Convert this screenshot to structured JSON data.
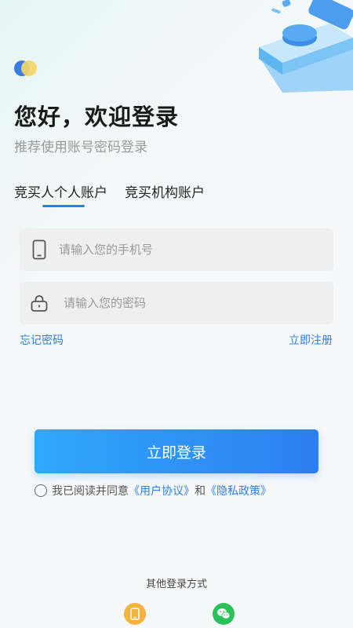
{
  "header": {
    "title": "您好，欢迎登录",
    "subtitle": "推荐使用账号密码登录"
  },
  "tabs": [
    {
      "label": "竞买人个人账户",
      "active": true
    },
    {
      "label": "竞买机构账户",
      "active": false
    }
  ],
  "form": {
    "phone_placeholder": "请输入您的手机号",
    "password_placeholder": "请输入您的密码",
    "forgot_label": "忘记密码",
    "register_label": "立即注册",
    "login_label": "立即登录"
  },
  "agreement": {
    "prefix": "我已阅读并同意",
    "user_protocol": "《用户协议》",
    "and": "和",
    "privacy_policy": "《隐私政策》"
  },
  "other_login": {
    "label": "其他登录方式",
    "methods": [
      "phone-icon",
      "wechat-icon"
    ]
  },
  "colors": {
    "accent": "#2d7ee6",
    "button_start": "#2fa8fb",
    "button_end": "#2d7ef0"
  }
}
